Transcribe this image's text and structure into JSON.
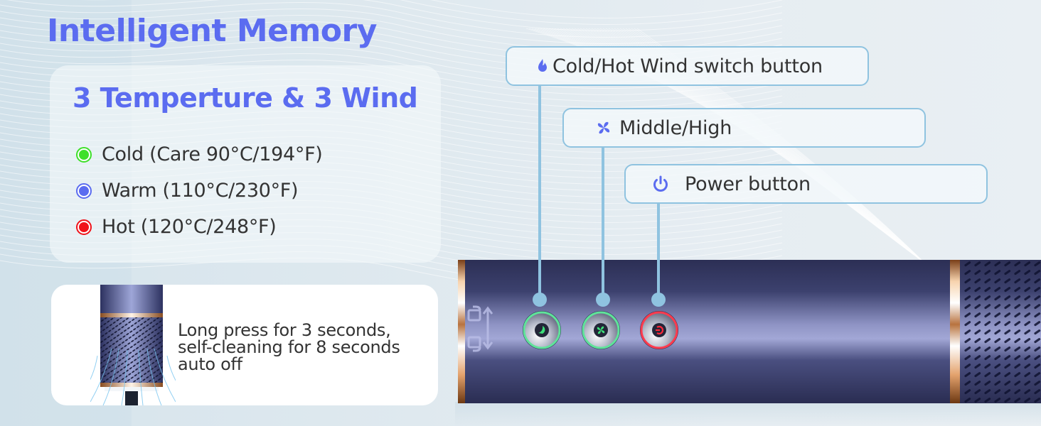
{
  "header": {
    "title": "Intelligent Memory"
  },
  "temperature_card": {
    "title": "3 Temperture & 3 Wind",
    "items": [
      {
        "label": "Cold (Care 90°C/194°F)",
        "color": "#3fe02a",
        "icon": "green-dot-icon"
      },
      {
        "label": "Warm (110°C/230°F)",
        "color": "#5b6cf0",
        "icon": "blue-dot-icon"
      },
      {
        "label": "Hot (120°C/248°F)",
        "color": "#f0131a",
        "icon": "red-dot-icon"
      }
    ]
  },
  "cleaning_card": {
    "lines": [
      "Long press for 3 seconds,",
      "self-cleaning for 8 seconds",
      "auto off"
    ]
  },
  "callouts": [
    {
      "label": "Cold/Hot Wind switch button",
      "icon": "flame-icon"
    },
    {
      "label": "Middle/High",
      "icon": "fan-icon"
    },
    {
      "label": "Power button",
      "icon": "power-icon"
    }
  ],
  "device_buttons": [
    {
      "name": "cold-hot-switch",
      "ring_color": "#5fe39a",
      "glyph_color": "#3ee07a",
      "icon": "flame-glyph-icon"
    },
    {
      "name": "wind-speed",
      "ring_color": "#5fe39a",
      "glyph_color": "#3ee07a",
      "icon": "fan-glyph-icon"
    },
    {
      "name": "power",
      "ring_color": "#ff3b4e",
      "glyph_color": "#ff2a3a",
      "icon": "power-glyph-icon"
    }
  ],
  "colors": {
    "accent": "#5b6cf0",
    "callout_border": "#8fc3e0",
    "device_body": "#353a62",
    "rose_gold": "#c98a55"
  }
}
